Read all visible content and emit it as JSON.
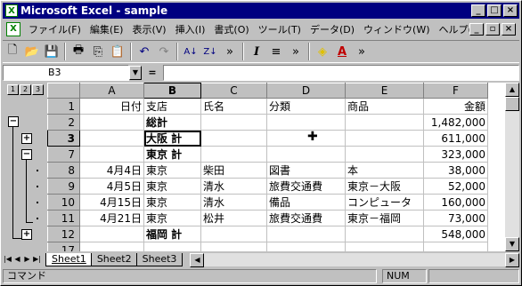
{
  "window": {
    "title": "Microsoft Excel - sample"
  },
  "menus": [
    "ファイル(F)",
    "編集(E)",
    "表示(V)",
    "挿入(I)",
    "書式(O)",
    "ツール(T)",
    "データ(D)",
    "ウィンドウ(W)",
    "ヘルプ(H)"
  ],
  "namebox": "B3",
  "formula_eq": "=",
  "outline_levels": [
    "1",
    "2",
    "3"
  ],
  "columns": [
    "A",
    "B",
    "C",
    "D",
    "E",
    "F"
  ],
  "rows": [
    {
      "num": "1",
      "cells": [
        "日付",
        "支店",
        "氏名",
        "分類",
        "商品",
        "金額"
      ]
    },
    {
      "num": "2",
      "cells": [
        "",
        "総計",
        "",
        "",
        "",
        "1,482,000"
      ]
    },
    {
      "num": "3",
      "cells": [
        "",
        "大阪 計",
        "",
        "",
        "",
        "611,000"
      ]
    },
    {
      "num": "7",
      "cells": [
        "",
        "東京 計",
        "",
        "",
        "",
        "323,000"
      ]
    },
    {
      "num": "8",
      "cells": [
        "4月4日",
        "東京",
        "柴田",
        "図書",
        "本",
        "38,000"
      ]
    },
    {
      "num": "9",
      "cells": [
        "4月5日",
        "東京",
        "清水",
        "旅費交通費",
        "東京－大阪",
        "52,000"
      ]
    },
    {
      "num": "10",
      "cells": [
        "4月15日",
        "東京",
        "清水",
        "備品",
        "コンピュータ",
        "160,000"
      ]
    },
    {
      "num": "11",
      "cells": [
        "4月21日",
        "東京",
        "松井",
        "旅費交通費",
        "東京－福岡",
        "73,000"
      ]
    },
    {
      "num": "12",
      "cells": [
        "",
        "福岡 計",
        "",
        "",
        "",
        "548,000"
      ]
    },
    {
      "num": "17",
      "cells": [
        "",
        "",
        "",
        "",
        "",
        ""
      ]
    }
  ],
  "sheets": [
    "Sheet1",
    "Sheet2",
    "Sheet3"
  ],
  "active_sheet": "Sheet1",
  "status": {
    "mode": "コマンド",
    "num": "NUM"
  },
  "colors": {
    "titlebar": "#000080",
    "face": "#c0c0c0"
  }
}
